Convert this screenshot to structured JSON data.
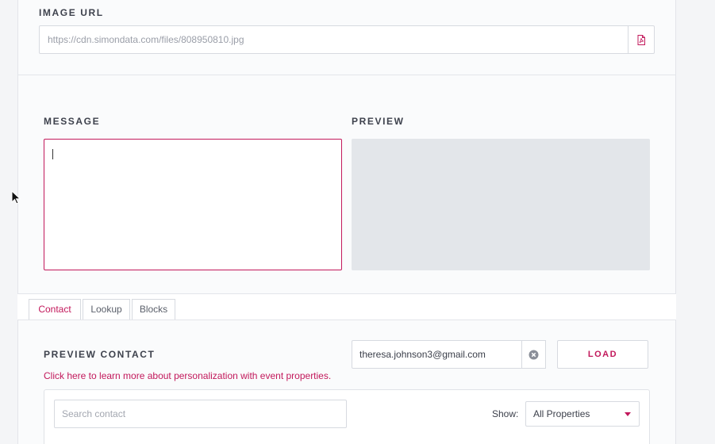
{
  "image_url": {
    "label": "IMAGE URL",
    "value": "https://cdn.simondata.com/files/808950810.jpg",
    "button_icon": "pdf-file-icon"
  },
  "message": {
    "label": "MESSAGE",
    "value": ""
  },
  "preview": {
    "label": "PREVIEW"
  },
  "tabs": [
    {
      "label": "Contact",
      "active": true
    },
    {
      "label": "Lookup",
      "active": false
    },
    {
      "label": "Blocks",
      "active": false
    }
  ],
  "preview_contact": {
    "label": "PREVIEW CONTACT",
    "email": "theresa.johnson3@gmail.com",
    "clear_icon": "clear-circle-icon",
    "load_label": "LOAD",
    "help_link": "Click here to learn more about personalization with event properties."
  },
  "properties": {
    "search_placeholder": "Search contact",
    "show_label": "Show:",
    "show_value": "All Properties"
  },
  "colors": {
    "accent": "#c2185b",
    "border": "#d7dae0",
    "panel_bg": "#fafbfc",
    "preview_bg": "#e3e6ea"
  }
}
